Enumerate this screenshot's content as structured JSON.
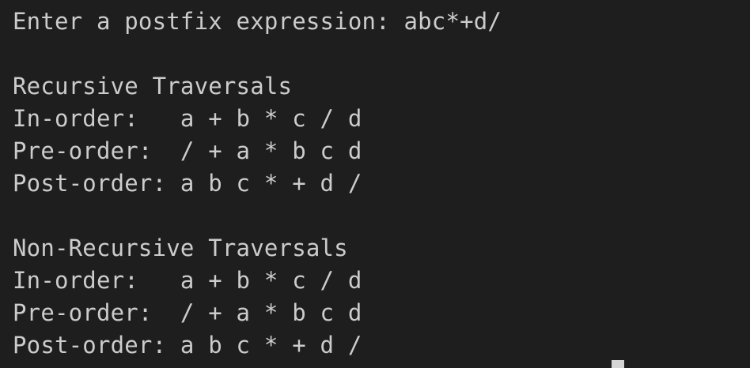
{
  "terminal": {
    "prompt_label": "Enter a postfix expression: ",
    "input_value": "abc*+d/",
    "recursive": {
      "heading": "Recursive Traversals",
      "inorder": "In-order:   a + b * c / d",
      "preorder": "Pre-order:  / + a * b c d",
      "postorder": "Post-order: a b c * + d /"
    },
    "nonrecursive": {
      "heading": "Non-Recursive Traversals",
      "inorder": "In-order:   a + b * c / d",
      "preorder": "Pre-order:  / + a * b c d",
      "postorder": "Post-order: a b c * + d /"
    }
  },
  "colors": {
    "background": "#1e1e1e",
    "text": "#cccccc",
    "cursor": "#d4d4d4"
  }
}
